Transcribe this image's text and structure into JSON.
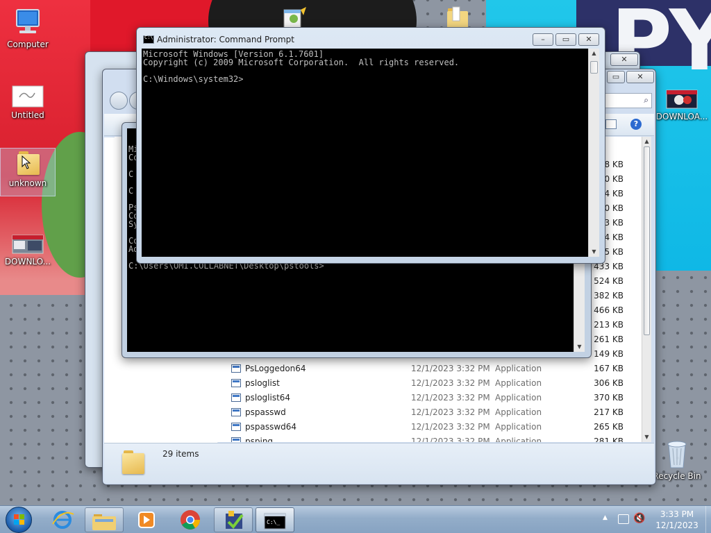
{
  "desktop": {
    "wallpaper_text": "PYT",
    "icons": [
      {
        "label": "Computer"
      },
      {
        "label": "Untitled"
      },
      {
        "label": "unknown"
      },
      {
        "label": "DOWNLO..."
      },
      {
        "label": "DOWNLOA..."
      },
      {
        "label": "Recycle Bin"
      }
    ]
  },
  "cmd_main": {
    "title": "Administrator: Command Prompt",
    "lines": [
      "Microsoft Windows [Version 6.1.7601]",
      "Copyright (c) 2009 Microsoft Corporation.  All rights reserved.",
      "",
      "C:\\Windows\\system32>"
    ]
  },
  "cmd_back": {
    "visible_prompt": "C:\\Users\\OMI.COLLABNET\\Desktop\\pstools>",
    "visible_fragments": [
      "Mi",
      "Co",
      "C",
      "C",
      "Ps",
      "Co",
      "Sy",
      "Co",
      "Ad"
    ]
  },
  "explorer": {
    "partial_sizes": [
      "8 KB",
      "00 KB",
      "14 KB",
      "30 KB",
      "33 KB",
      "04 KB",
      "95 KB",
      "433 KB",
      "524 KB",
      "382 KB",
      "466 KB",
      "213 KB",
      "261 KB",
      "149 KB"
    ],
    "files": [
      {
        "name": "PsLoggedon64",
        "date": "12/1/2023 3:32 PM",
        "type": "Application",
        "size": "167 KB"
      },
      {
        "name": "psloglist",
        "date": "12/1/2023 3:32 PM",
        "type": "Application",
        "size": "306 KB"
      },
      {
        "name": "psloglist64",
        "date": "12/1/2023 3:32 PM",
        "type": "Application",
        "size": "370 KB"
      },
      {
        "name": "pspasswd",
        "date": "12/1/2023 3:32 PM",
        "type": "Application",
        "size": "217 KB"
      },
      {
        "name": "pspasswd64",
        "date": "12/1/2023 3:32 PM",
        "type": "Application",
        "size": "265 KB"
      },
      {
        "name": "psping",
        "date": "12/1/2023 3:32 PM",
        "type": "Application",
        "size": "281 KB"
      }
    ],
    "status": "29 items"
  },
  "taskbar": {
    "pinned": [
      "start-orb",
      "internet-explorer",
      "windows-explorer",
      "media-player",
      "chrome",
      "checklist-app",
      "command-prompt"
    ],
    "clock_time": "3:33 PM",
    "clock_date": "12/1/2023"
  }
}
